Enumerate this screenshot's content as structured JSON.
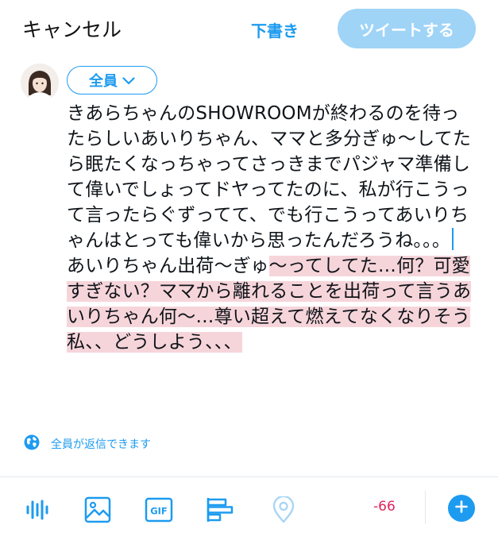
{
  "header": {
    "cancel_label": "キャンセル",
    "drafts_label": "下書き",
    "tweet_label": "ツイートする"
  },
  "audience": {
    "label": "全員"
  },
  "composer": {
    "lines": [
      "きあらちゃんのSHOWROOMが終わるのを待っ",
      "たらしいあいりちゃん、ママと多分ぎゅ〜してた",
      "ら眠たくなっちゃってさっきまでパジャマ準備し",
      "て偉いでしょってドヤってたのに、私が行こうっ",
      "て言ったらぐずってて、でも行こうってあいりち",
      "ゃんはとっても偉いから思ったんだろうね。。。",
      "あいりちゃん出荷〜ぎゅ"
    ],
    "overflow_lines": [
      "〜ってしてた…何？可愛",
      "すぎない？ママから離れることを出荷って言うあ",
      "いりちゃん何〜…尊い超えて燃えてなくなりそう",
      "私、、どうしよう、、、"
    ]
  },
  "reply_setting": {
    "label": "全員が返信できます"
  },
  "toolbar": {
    "icons": [
      "voice-tweet-icon",
      "image-icon",
      "gif-icon",
      "poll-icon",
      "location-icon"
    ],
    "gif_label": "GIF",
    "char_counter": "-66"
  },
  "colors": {
    "accent": "#1d9bf0",
    "disabled_button": "#9fd4f7",
    "overflow_highlight": "#f6d5da",
    "counter_negative": "#e0245e"
  }
}
